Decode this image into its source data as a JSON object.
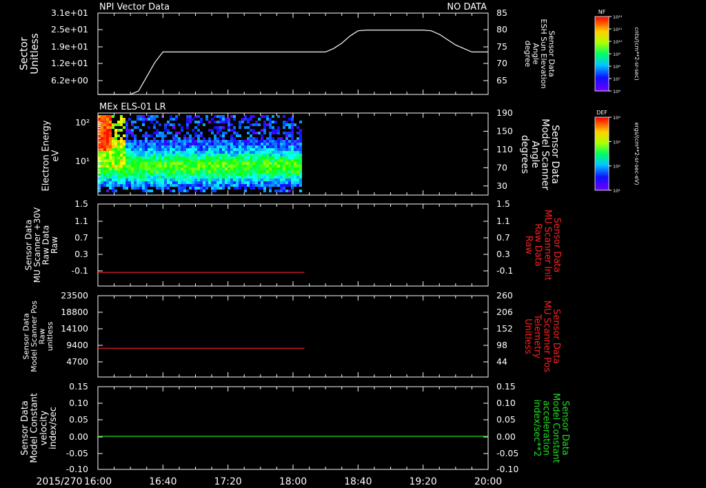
{
  "chart_data": [
    {
      "type": "line",
      "title_left": "NPI Vector Data",
      "title_right": "NO DATA",
      "ylabel_left": [
        "Sector",
        "Unitless"
      ],
      "ylabel_right": [
        "Sensor Data",
        "ESH Sun Elevation",
        "Angle",
        "degree"
      ],
      "ylabel_right_color": "#ffffff",
      "ytick_left": [
        "3.1e+01",
        "2.5e+01",
        "1.9e+01",
        "1.2e+01",
        "6.2e+00"
      ],
      "ytick_right": [
        "85",
        "80",
        "75",
        "70",
        "65"
      ],
      "ylim_right": [
        62,
        85
      ],
      "series": [
        {
          "color": "#ffffff",
          "x": [
            "16:00",
            "16:20",
            "16:25",
            "16:30",
            "16:35",
            "16:40",
            "16:50",
            "17:00",
            "17:20",
            "17:40",
            "18:00",
            "18:10",
            "18:20",
            "18:25",
            "18:30",
            "18:35",
            "18:40",
            "18:45",
            "18:50",
            "19:00",
            "19:10",
            "19:20",
            "19:25",
            "19:30",
            "19:35",
            "19:40",
            "19:45",
            "19:50",
            "19:55",
            "20:00"
          ],
          "y": [
            62,
            62,
            63,
            67,
            71,
            74,
            74,
            74,
            74,
            74,
            74,
            74,
            74,
            75,
            76.5,
            78.5,
            80,
            80.2,
            80.2,
            80.2,
            80.2,
            80.2,
            80,
            79,
            77.5,
            76,
            75,
            74,
            74,
            74
          ]
        }
      ]
    },
    {
      "type": "heatmap",
      "title_left": "MEx ELS-01 LR",
      "ylabel_left": [
        "Electron Energy",
        "eV"
      ],
      "ylabel_right": [
        "Sensor Data",
        "Model Scanner",
        "Angle",
        "degrees"
      ],
      "ylabel_right_color": "#ffffff",
      "ytick_left": [
        "10²",
        "10¹"
      ],
      "ytick_right": [
        "190",
        "150",
        "110",
        "70",
        "30"
      ],
      "ylim_left_log10": [
        0.12,
        2.25
      ],
      "ylim_right": [
        10,
        190
      ],
      "x_range": [
        "16:00",
        "18:05"
      ],
      "constant_line_right_deg": 10,
      "constant_line_color": "#ffffff"
    },
    {
      "type": "line",
      "ylabel_left": [
        "Sensor Data",
        "MU Scanner +30V",
        "Raw Data",
        "Raw"
      ],
      "ylabel_right": [
        "Sensor Data",
        "MU Scanner Init",
        "Raw Data",
        "Raw"
      ],
      "ylabel_right_color": "#ff2020",
      "ytick_left": [
        "1.5",
        "1.1",
        "0.7",
        "0.3",
        "-0.1"
      ],
      "ytick_right": [
        "1.5",
        "1.1",
        "0.7",
        "0.3",
        "-0.1"
      ],
      "ylim": [
        -0.3,
        1.5
      ],
      "series": [
        {
          "color": "#ff2020",
          "x": [
            "16:00",
            "18:07"
          ],
          "y": [
            0,
            0
          ]
        }
      ]
    },
    {
      "type": "line",
      "ylabel_left": [
        "Sensor Data",
        "Model Scanner Pos",
        "Raw",
        "unitless"
      ],
      "ylabel_right": [
        "Sensor Data",
        "MU Scanner Pos",
        "Telemetry",
        "Unitless"
      ],
      "ylabel_right_color": "#ff2020",
      "ytick_left": [
        "23500",
        "18800",
        "14100",
        "9400",
        "4700"
      ],
      "ytick_right": [
        "260",
        "206",
        "152",
        "98",
        "44"
      ],
      "ylim": [
        0,
        23500
      ],
      "series": [
        {
          "color": "#ff2020",
          "x": [
            "16:00",
            "18:07"
          ],
          "y": [
            8300,
            8300
          ]
        }
      ]
    },
    {
      "type": "line",
      "ylabel_left": [
        "Sensor Data",
        "Model Constant",
        "velocity",
        "index/sec"
      ],
      "ylabel_right": [
        "Sensor Data",
        "Model Constant",
        "acceleration",
        "index/sec**2"
      ],
      "ylabel_right_color": "#20e020",
      "ytick_left": [
        "0.15",
        "0.10",
        "0.05",
        "0.00",
        "-0.05",
        "-0.10"
      ],
      "ytick_right": [
        "0.15",
        "0.10",
        "0.05",
        "0.00",
        "-0.05",
        "-0.10"
      ],
      "ylim": [
        -0.1,
        0.15
      ],
      "series": [
        {
          "color": "#20e020",
          "x": [
            "16:00",
            "20:00"
          ],
          "y": [
            0,
            0
          ]
        }
      ]
    }
  ],
  "x_axis": {
    "date": "2015/270",
    "ticks": [
      "16:00",
      "16:40",
      "17:20",
      "18:00",
      "18:40",
      "19:20",
      "20:00"
    ],
    "range": [
      "16:00",
      "20:00"
    ]
  },
  "colorbars": [
    {
      "tag": "NF",
      "label": "cnts/(cm**2-sr-sec)",
      "ticks": [
        "10¹²",
        "10¹¹",
        "10¹⁰",
        "10⁹",
        "10⁸",
        "10⁷",
        "10⁶"
      ]
    },
    {
      "tag": "DEF",
      "label": "ergs/(cm**2-sr-sec-eV)",
      "ticks": [
        "10⁴",
        "10³",
        "10²",
        "10¹"
      ]
    }
  ]
}
